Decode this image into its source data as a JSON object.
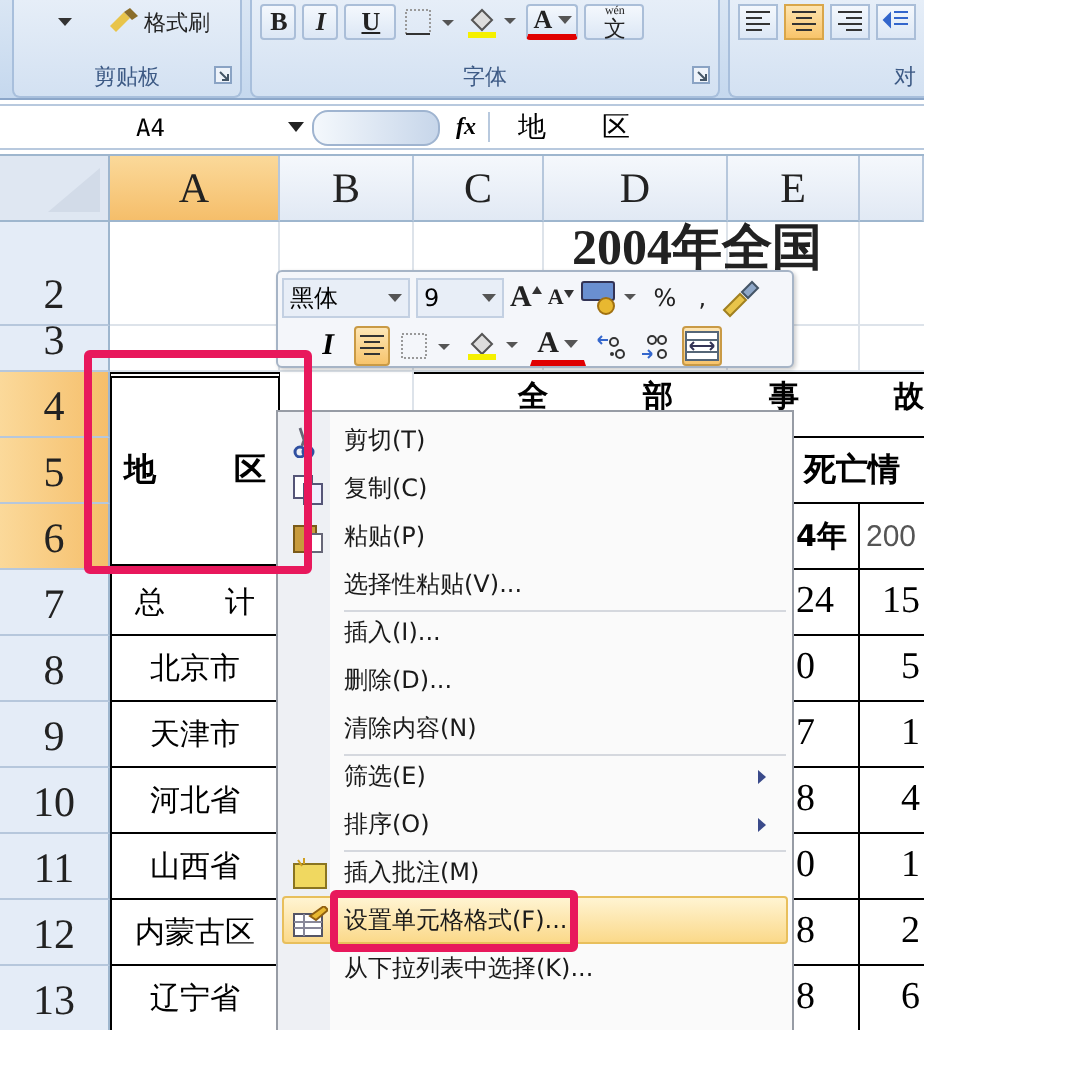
{
  "ribbon": {
    "groups": [
      {
        "label": "剪贴板",
        "launcher": true
      },
      {
        "label": "字体",
        "launcher": true
      },
      {
        "label": "对"
      }
    ],
    "format_painter": "格式刷",
    "font_buttons": [
      {
        "kind": "bold",
        "label": "B"
      },
      {
        "kind": "italic",
        "label": "I"
      },
      {
        "kind": "underline",
        "label": "U"
      },
      {
        "kind": "border"
      },
      {
        "kind": "fill"
      },
      {
        "kind": "color",
        "label": "A"
      },
      {
        "kind": "phonetic",
        "label": "文",
        "hint": "wén"
      }
    ],
    "align_buttons": [
      {
        "kind": "left",
        "selected": false
      },
      {
        "kind": "center",
        "selected": true
      },
      {
        "kind": "right",
        "selected": false
      },
      {
        "kind": "indent",
        "selected": false
      }
    ]
  },
  "formula_bar": {
    "name_box": "A4",
    "fx": "fx",
    "value": "地　　区"
  },
  "columns": [
    {
      "label": "A",
      "selected": true
    },
    {
      "label": "B",
      "selected": false
    },
    {
      "label": "C",
      "selected": false
    },
    {
      "label": "D",
      "selected": false
    },
    {
      "label": "E",
      "selected": false
    }
  ],
  "rows": [
    {
      "label": "2",
      "selected": false
    },
    {
      "label": "3",
      "selected": false
    },
    {
      "label": "4",
      "selected": true
    },
    {
      "label": "5",
      "selected": true
    },
    {
      "label": "6",
      "selected": true
    },
    {
      "label": "7",
      "selected": false
    },
    {
      "label": "8",
      "selected": false
    },
    {
      "label": "9",
      "selected": false
    },
    {
      "label": "10",
      "selected": false
    },
    {
      "label": "11",
      "selected": false
    },
    {
      "label": "12",
      "selected": false
    },
    {
      "label": "13",
      "selected": false
    }
  ],
  "title": "2004年全国",
  "table": {
    "region_header": {
      "text": "地　　区",
      "highlighted": true
    },
    "group_header": "全　部　事　故",
    "sub_header": "死亡情",
    "year_headers": [
      "4年",
      "200"
    ],
    "rows": [
      {
        "region": "总　　计",
        "column_e": "24",
        "column_f": "15"
      },
      {
        "region": "北京市",
        "column_e": "0",
        "column_f": "5"
      },
      {
        "region": "天津市",
        "column_e": "7",
        "column_f": "1"
      },
      {
        "region": "河北省",
        "column_e": "8",
        "column_f": "4"
      },
      {
        "region": "山西省",
        "column_e": "0",
        "column_f": "1"
      },
      {
        "region": "内蒙古区",
        "column_e": "8",
        "column_f": "2"
      },
      {
        "region": "辽宁省",
        "column_e": "8",
        "column_f": "6"
      }
    ]
  },
  "mini_toolbar": {
    "font": "黑体",
    "size": "9",
    "top_buttons": [
      {
        "kind": "grow",
        "label": "A"
      },
      {
        "kind": "shrink",
        "label": "A"
      },
      {
        "kind": "accounting"
      },
      {
        "kind": "percent",
        "label": "%"
      },
      {
        "kind": "comma",
        "label": ","
      },
      {
        "kind": "painter"
      }
    ],
    "bottom_buttons": [
      {
        "kind": "italic",
        "label": "I",
        "selected": false
      },
      {
        "kind": "center",
        "selected": true
      },
      {
        "kind": "border",
        "selected": false
      },
      {
        "kind": "fill",
        "selected": false
      },
      {
        "kind": "color",
        "label": "A",
        "selected": false
      },
      {
        "kind": "more-decimals",
        "selected": false
      },
      {
        "kind": "fewer-decimals",
        "selected": false
      },
      {
        "kind": "merge",
        "selected": true
      }
    ]
  },
  "context_menu": {
    "items": [
      {
        "label": "剪切(T)",
        "kind": "cut",
        "separator": false,
        "submenu": false,
        "selected": false,
        "highlighted": false
      },
      {
        "label": "复制(C)",
        "kind": "copy",
        "separator": false,
        "submenu": false,
        "selected": false,
        "highlighted": false
      },
      {
        "label": "粘贴(P)",
        "kind": "paste",
        "separator": false,
        "submenu": false,
        "selected": false,
        "highlighted": false
      },
      {
        "label": "选择性粘贴(V)...",
        "kind": "plain",
        "separator": false,
        "submenu": false,
        "selected": false,
        "highlighted": false
      },
      {
        "label": "插入(I)...",
        "kind": "plain",
        "separator": true,
        "submenu": false,
        "selected": false,
        "highlighted": false
      },
      {
        "label": "删除(D)...",
        "kind": "plain",
        "separator": false,
        "submenu": false,
        "selected": false,
        "highlighted": false
      },
      {
        "label": "清除内容(N)",
        "kind": "plain",
        "separator": false,
        "submenu": false,
        "selected": false,
        "highlighted": false
      },
      {
        "label": "筛选(E)",
        "kind": "plain",
        "separator": true,
        "submenu": true,
        "selected": false,
        "highlighted": false
      },
      {
        "label": "排序(O)",
        "kind": "plain",
        "separator": false,
        "submenu": true,
        "selected": false,
        "highlighted": false
      },
      {
        "label": "插入批注(M)",
        "kind": "comment",
        "separator": true,
        "submenu": false,
        "selected": false,
        "highlighted": false
      },
      {
        "label": "设置单元格格式(F)...",
        "kind": "format",
        "separator": false,
        "submenu": false,
        "selected": true,
        "highlighted": true
      },
      {
        "label": "从下拉列表中选择(K)...",
        "kind": "plain",
        "separator": false,
        "submenu": false,
        "selected": false,
        "highlighted": false
      }
    ]
  }
}
